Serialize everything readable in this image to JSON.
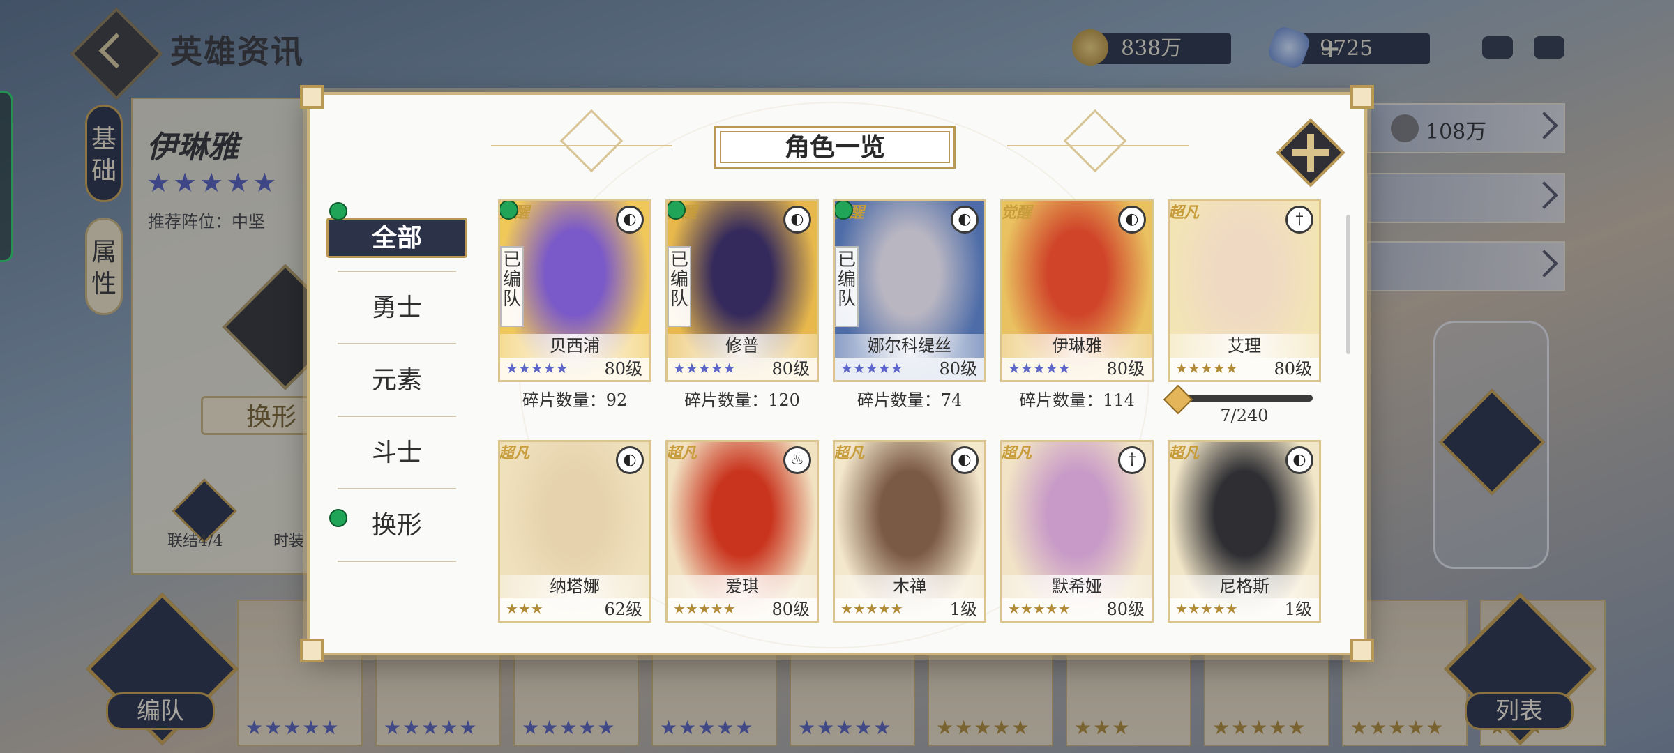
{
  "page": {
    "title": "英雄资讯",
    "currencies": [
      {
        "icon": "gold-coin-icon",
        "value": "838万"
      },
      {
        "icon": "diamond-icon",
        "value": "9725",
        "add": "+"
      }
    ]
  },
  "hero_panel": {
    "tabs": [
      "基\n础",
      "属\n性"
    ],
    "name": "伊琳雅",
    "stars": "★★★★★",
    "recommend": "推荐阵位：中坚",
    "transform_btn": "换形",
    "link_label": "联结4/4",
    "time_label": "时装"
  },
  "right_bars": {
    "power": "108万"
  },
  "bottom": {
    "team_label": "编队",
    "list_label": "列表",
    "strip_stars": [
      "★★★★★",
      "★★★★★",
      "★★★★★",
      "★★★★★",
      "★★★★★",
      "★★★★★",
      "★★★",
      "★★★★★",
      "★★★★★",
      "★★★"
    ]
  },
  "modal": {
    "title": "角色一览",
    "categories": [
      {
        "label": "全部",
        "active": true,
        "dot": true
      },
      {
        "label": "勇士",
        "active": false,
        "dot": false
      },
      {
        "label": "元素",
        "active": false,
        "dot": false
      },
      {
        "label": "斗士",
        "active": false,
        "dot": false
      },
      {
        "label": "换形",
        "active": false,
        "dot": true
      }
    ],
    "cards": [
      {
        "name": "贝西浦",
        "level": "80级",
        "stars": "★★★★★",
        "star_type": "awake",
        "badge": "觉醒",
        "in_team": "已\n编\n队",
        "class": "mask",
        "footer": "碎片数量：92",
        "colors": [
          "#7a59c9",
          "#f0c85a"
        ],
        "green": true
      },
      {
        "name": "修普",
        "level": "80级",
        "stars": "★★★★★",
        "star_type": "awake",
        "badge": "觉醒",
        "in_team": "已\n编\n队",
        "class": "mask",
        "footer": "碎片数量：120",
        "colors": [
          "#352a5c",
          "#e8b84c"
        ],
        "green": true
      },
      {
        "name": "娜尔科缇丝",
        "level": "80级",
        "stars": "★★★★★",
        "star_type": "awake",
        "badge": "觉醒",
        "in_team": "已\n编\n队",
        "class": "mask",
        "footer": "碎片数量：74",
        "colors": [
          "#b9b6c2",
          "#4d6ca8"
        ],
        "green": true
      },
      {
        "name": "伊琳雅",
        "level": "80级",
        "stars": "★★★★★",
        "star_type": "awake",
        "badge": "觉醒",
        "in_team": "",
        "class": "mask",
        "footer": "碎片数量：114",
        "colors": [
          "#d0452a",
          "#e9c160"
        ],
        "green": false
      },
      {
        "name": "艾理",
        "level": "80级",
        "stars": "★★★★★",
        "star_type": "gold",
        "badge": "超凡",
        "in_team": "",
        "class": "sword",
        "progress": {
          "text": "7/240",
          "fraction": 0.029
        },
        "colors": [
          "#efd9c3",
          "#f3e4b6"
        ],
        "green": false
      },
      {
        "name": "纳塔娜",
        "level": "62级",
        "stars": "★★★",
        "star_type": "gold",
        "badge": "超凡",
        "in_team": "",
        "class": "mask",
        "colors": [
          "#e6d3ad",
          "#f0e1bd"
        ],
        "green": false
      },
      {
        "name": "爱琪",
        "level": "80级",
        "stars": "★★★★★",
        "star_type": "gold",
        "badge": "超凡",
        "in_team": "",
        "class": "flask",
        "colors": [
          "#c9341e",
          "#f1e2c2"
        ],
        "green": false
      },
      {
        "name": "木禅",
        "level": "1级",
        "stars": "★★★★★",
        "star_type": "gold",
        "badge": "超凡",
        "in_team": "",
        "class": "mask",
        "colors": [
          "#7b5a45",
          "#f3e7cc"
        ],
        "green": false
      },
      {
        "name": "默希娅",
        "level": "80级",
        "stars": "★★★★★",
        "star_type": "gold",
        "badge": "超凡",
        "in_team": "",
        "class": "sword",
        "colors": [
          "#c89ac7",
          "#f1e4c6"
        ],
        "green": false
      },
      {
        "name": "尼格斯",
        "level": "1级",
        "stars": "★★★★★",
        "star_type": "gold",
        "badge": "超凡",
        "in_team": "",
        "class": "mask",
        "colors": [
          "#2f2f33",
          "#f2e6c8"
        ],
        "green": false
      }
    ]
  }
}
